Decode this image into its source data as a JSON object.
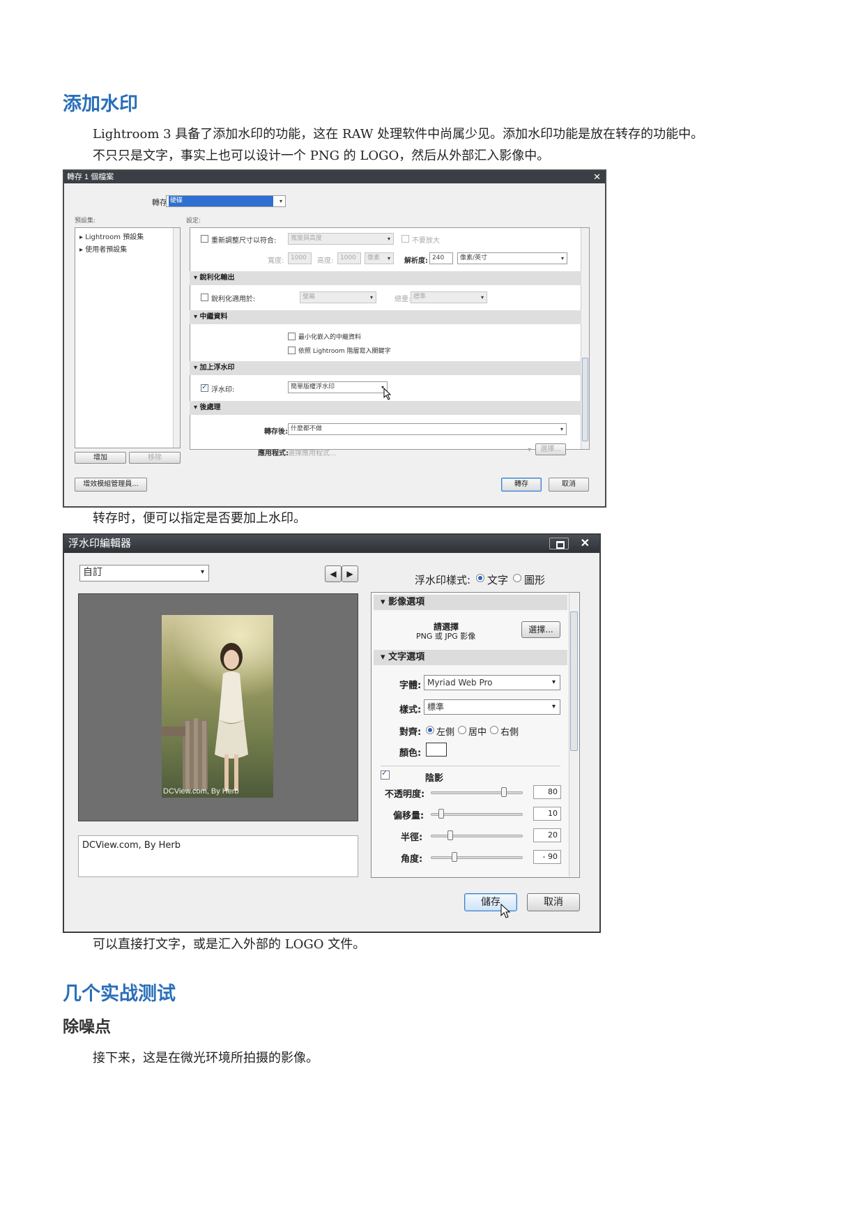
{
  "section1": {
    "title": "添加水印",
    "para1_line1": "Lightroom 3 具备了添加水印的功能，这在 RAW 处理软件中尚属少见。添加水印功能是放在转存的功能中。",
    "para1_line2": "不只只是文字，事实上也可以设计一个 PNG 的 LOGO，然后从外部汇入影像中。",
    "caption1": "转存时，便可以指定是否要加上水印。",
    "caption2": "可以直接打文字，或是汇入外部的 LOGO 文件。"
  },
  "section2": {
    "title": "几个实战测试",
    "subtitle": "除噪点",
    "para": "接下来，这是在微光环境所拍摄的影像。"
  },
  "export_dialog": {
    "title": "轉存 1 個檔案",
    "export_to_label": "轉存至:",
    "export_to_value": "硬碟",
    "presets_label": "預設集:",
    "settings_label": "設定:",
    "presets": [
      "Lightroom 預設集",
      "使用者預設集"
    ],
    "resize_label": "重新調整尺寸以符合:",
    "resize_value": "寬度與高度",
    "dont_enlarge": "不要放大",
    "width_label": "寬度:",
    "width_value": "1000",
    "height_label": "高度:",
    "height_value": "1000",
    "unit_value": "像素",
    "resolution_label": "解析度:",
    "resolution_value": "240",
    "res_unit_value": "像素/英寸",
    "sharpen_section": "銳利化輸出",
    "sharpen_for_label": "銳利化適用於:",
    "sharpen_for_value": "螢幕",
    "amount_label": "總量:",
    "amount_value": "標準",
    "metadata_section": "中繼資料",
    "minimize_metadata": "最小化嵌入的中繼資料",
    "write_keywords": "依照 Lightroom 階層寫入關鍵字",
    "watermark_section": "加上浮水印",
    "watermark_label": "浮水印:",
    "watermark_value": "簡單版權浮水印",
    "post_section": "後處理",
    "after_export_label": "轉存後:",
    "after_export_value": "什麼都不做",
    "application_label": "應用程式:",
    "application_value": "選擇應用程式...",
    "choose_btn": "選擇...",
    "add_btn": "增加",
    "remove_btn": "移除",
    "plugin_manager_btn": "增效模組管理員...",
    "export_btn": "轉存",
    "cancel_btn": "取消"
  },
  "watermark_editor": {
    "title": "浮水印編輯器",
    "preset_value": "自訂",
    "style_label": "浮水印樣式:",
    "style_text": "文字",
    "style_graphic": "圖形",
    "image_options": "影像選項",
    "please_choose": "請選擇",
    "png_or_jpg": "PNG 或 JPG 影像",
    "choose_btn": "選擇...",
    "text_options": "文字選項",
    "font_label": "字體:",
    "font_value": "Myriad Web Pro",
    "style_field_label": "樣式:",
    "style_field_value": "標準",
    "align_label": "對齊:",
    "align_left": "左側",
    "align_center": "居中",
    "align_right": "右側",
    "color_label": "顏色:",
    "shadow_label": "陰影",
    "opacity_label": "不透明度:",
    "opacity_value": "80",
    "offset_label": "偏移量:",
    "offset_value": "10",
    "radius_label": "半徑:",
    "radius_value": "20",
    "angle_label": "角度:",
    "angle_value": "- 90",
    "photo_watermark": "DCView.com, By Herb",
    "text_input": "DCView.com, By Herb",
    "save_btn": "儲存",
    "cancel_btn": "取消"
  }
}
